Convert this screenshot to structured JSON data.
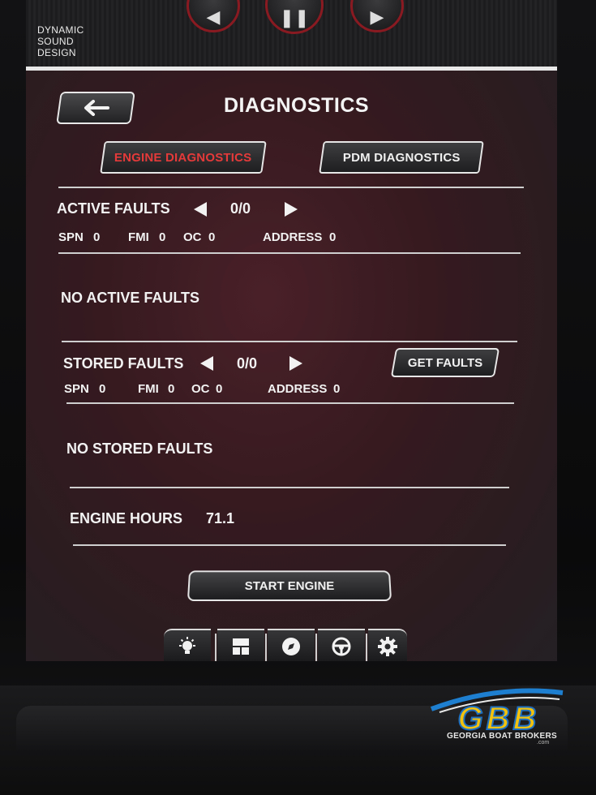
{
  "brand": {
    "line1": "DYNAMIC",
    "line2": "SOUND",
    "line3": "DESIGN"
  },
  "media": {
    "prev_icon": "rewind-icon",
    "pause_icon": "pause-icon",
    "next_icon": "play-icon"
  },
  "header": {
    "title": "DIAGNOSTICS",
    "back_icon": "arrow-left-icon"
  },
  "tabs": [
    {
      "label": "ENGINE DIAGNOSTICS",
      "active": true,
      "color": "#e53a3a"
    },
    {
      "label": "PDM DIAGNOSTICS",
      "active": false
    }
  ],
  "active_faults": {
    "label": "ACTIVE FAULTS",
    "counter": "0/0",
    "spn_label": "SPN",
    "spn_value": "0",
    "fmi_label": "FMI",
    "fmi_value": "0",
    "oc_label": "OC",
    "oc_value": "0",
    "address_label": "ADDRESS",
    "address_value": "0",
    "message": "NO ACTIVE FAULTS"
  },
  "stored_faults": {
    "label": "STORED FAULTS",
    "counter": "0/0",
    "get_faults_label": "GET FAULTS",
    "spn_label": "SPN",
    "spn_value": "0",
    "fmi_label": "FMI",
    "fmi_value": "0",
    "oc_label": "OC",
    "oc_value": "0",
    "address_label": "ADDRESS",
    "address_value": "0",
    "message": "NO STORED FAULTS"
  },
  "engine_hours": {
    "label": "ENGINE HOURS",
    "value": "71.1"
  },
  "start_engine_label": "START ENGINE",
  "nav": [
    {
      "icon": "lightbulb-icon",
      "active": false
    },
    {
      "icon": "dashboard-icon",
      "active": false
    },
    {
      "icon": "compass-icon",
      "active": false
    },
    {
      "icon": "steering-wheel-icon",
      "active": false
    },
    {
      "icon": "gear-icon",
      "active": true,
      "color": "#d92a2a"
    }
  ],
  "watermark": {
    "logo_text": "GBB",
    "caption": "GEORGIA BOAT BROKERS",
    "sub": ".com"
  }
}
